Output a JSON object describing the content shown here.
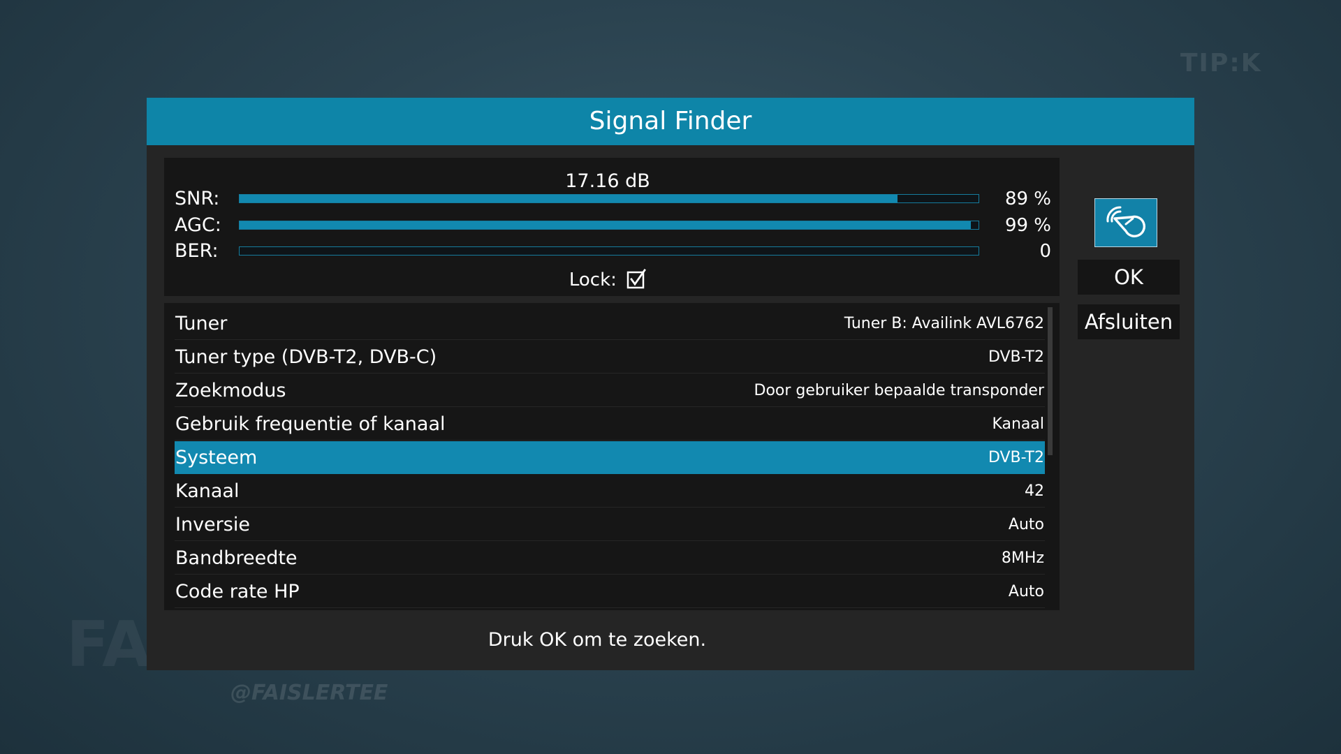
{
  "background": {
    "watermark_right": "TIP:K",
    "social_handle": "@FAISLERTEE",
    "brand_text": "FAIS-LE!"
  },
  "dialog": {
    "title": "Signal Finder",
    "accent_color": "#0e85a8"
  },
  "signal": {
    "db": "17.16 dB",
    "meters": [
      {
        "label": "SNR:",
        "percent": 89,
        "value": "89 %"
      },
      {
        "label": "AGC:",
        "percent": 99,
        "value": "99 %"
      },
      {
        "label": "BER:",
        "percent": 0,
        "value": "0"
      }
    ],
    "lock_label": "Lock:",
    "locked": true
  },
  "settings": [
    {
      "label": "Tuner",
      "value": "Tuner B: Availink AVL6762",
      "selected": false
    },
    {
      "label": "Tuner type (DVB-T2, DVB-C)",
      "value": "DVB-T2",
      "selected": false
    },
    {
      "label": "Zoekmodus",
      "value": "Door gebruiker bepaalde transponder",
      "selected": false
    },
    {
      "label": "Gebruik frequentie of kanaal",
      "value": "Kanaal",
      "selected": false
    },
    {
      "label": "Systeem",
      "value": "DVB-T2",
      "selected": true
    },
    {
      "label": "Kanaal",
      "value": "42",
      "selected": false
    },
    {
      "label": "Inversie",
      "value": "Auto",
      "selected": false
    },
    {
      "label": "Bandbreedte",
      "value": "8MHz",
      "selected": false
    },
    {
      "label": "Code rate HP",
      "value": "Auto",
      "selected": false
    }
  ],
  "actions": {
    "icon": "satellite-dish-icon",
    "ok_label": "OK",
    "close_label": "Afsluiten"
  },
  "footer": {
    "hint": "Druk OK om te zoeken."
  }
}
